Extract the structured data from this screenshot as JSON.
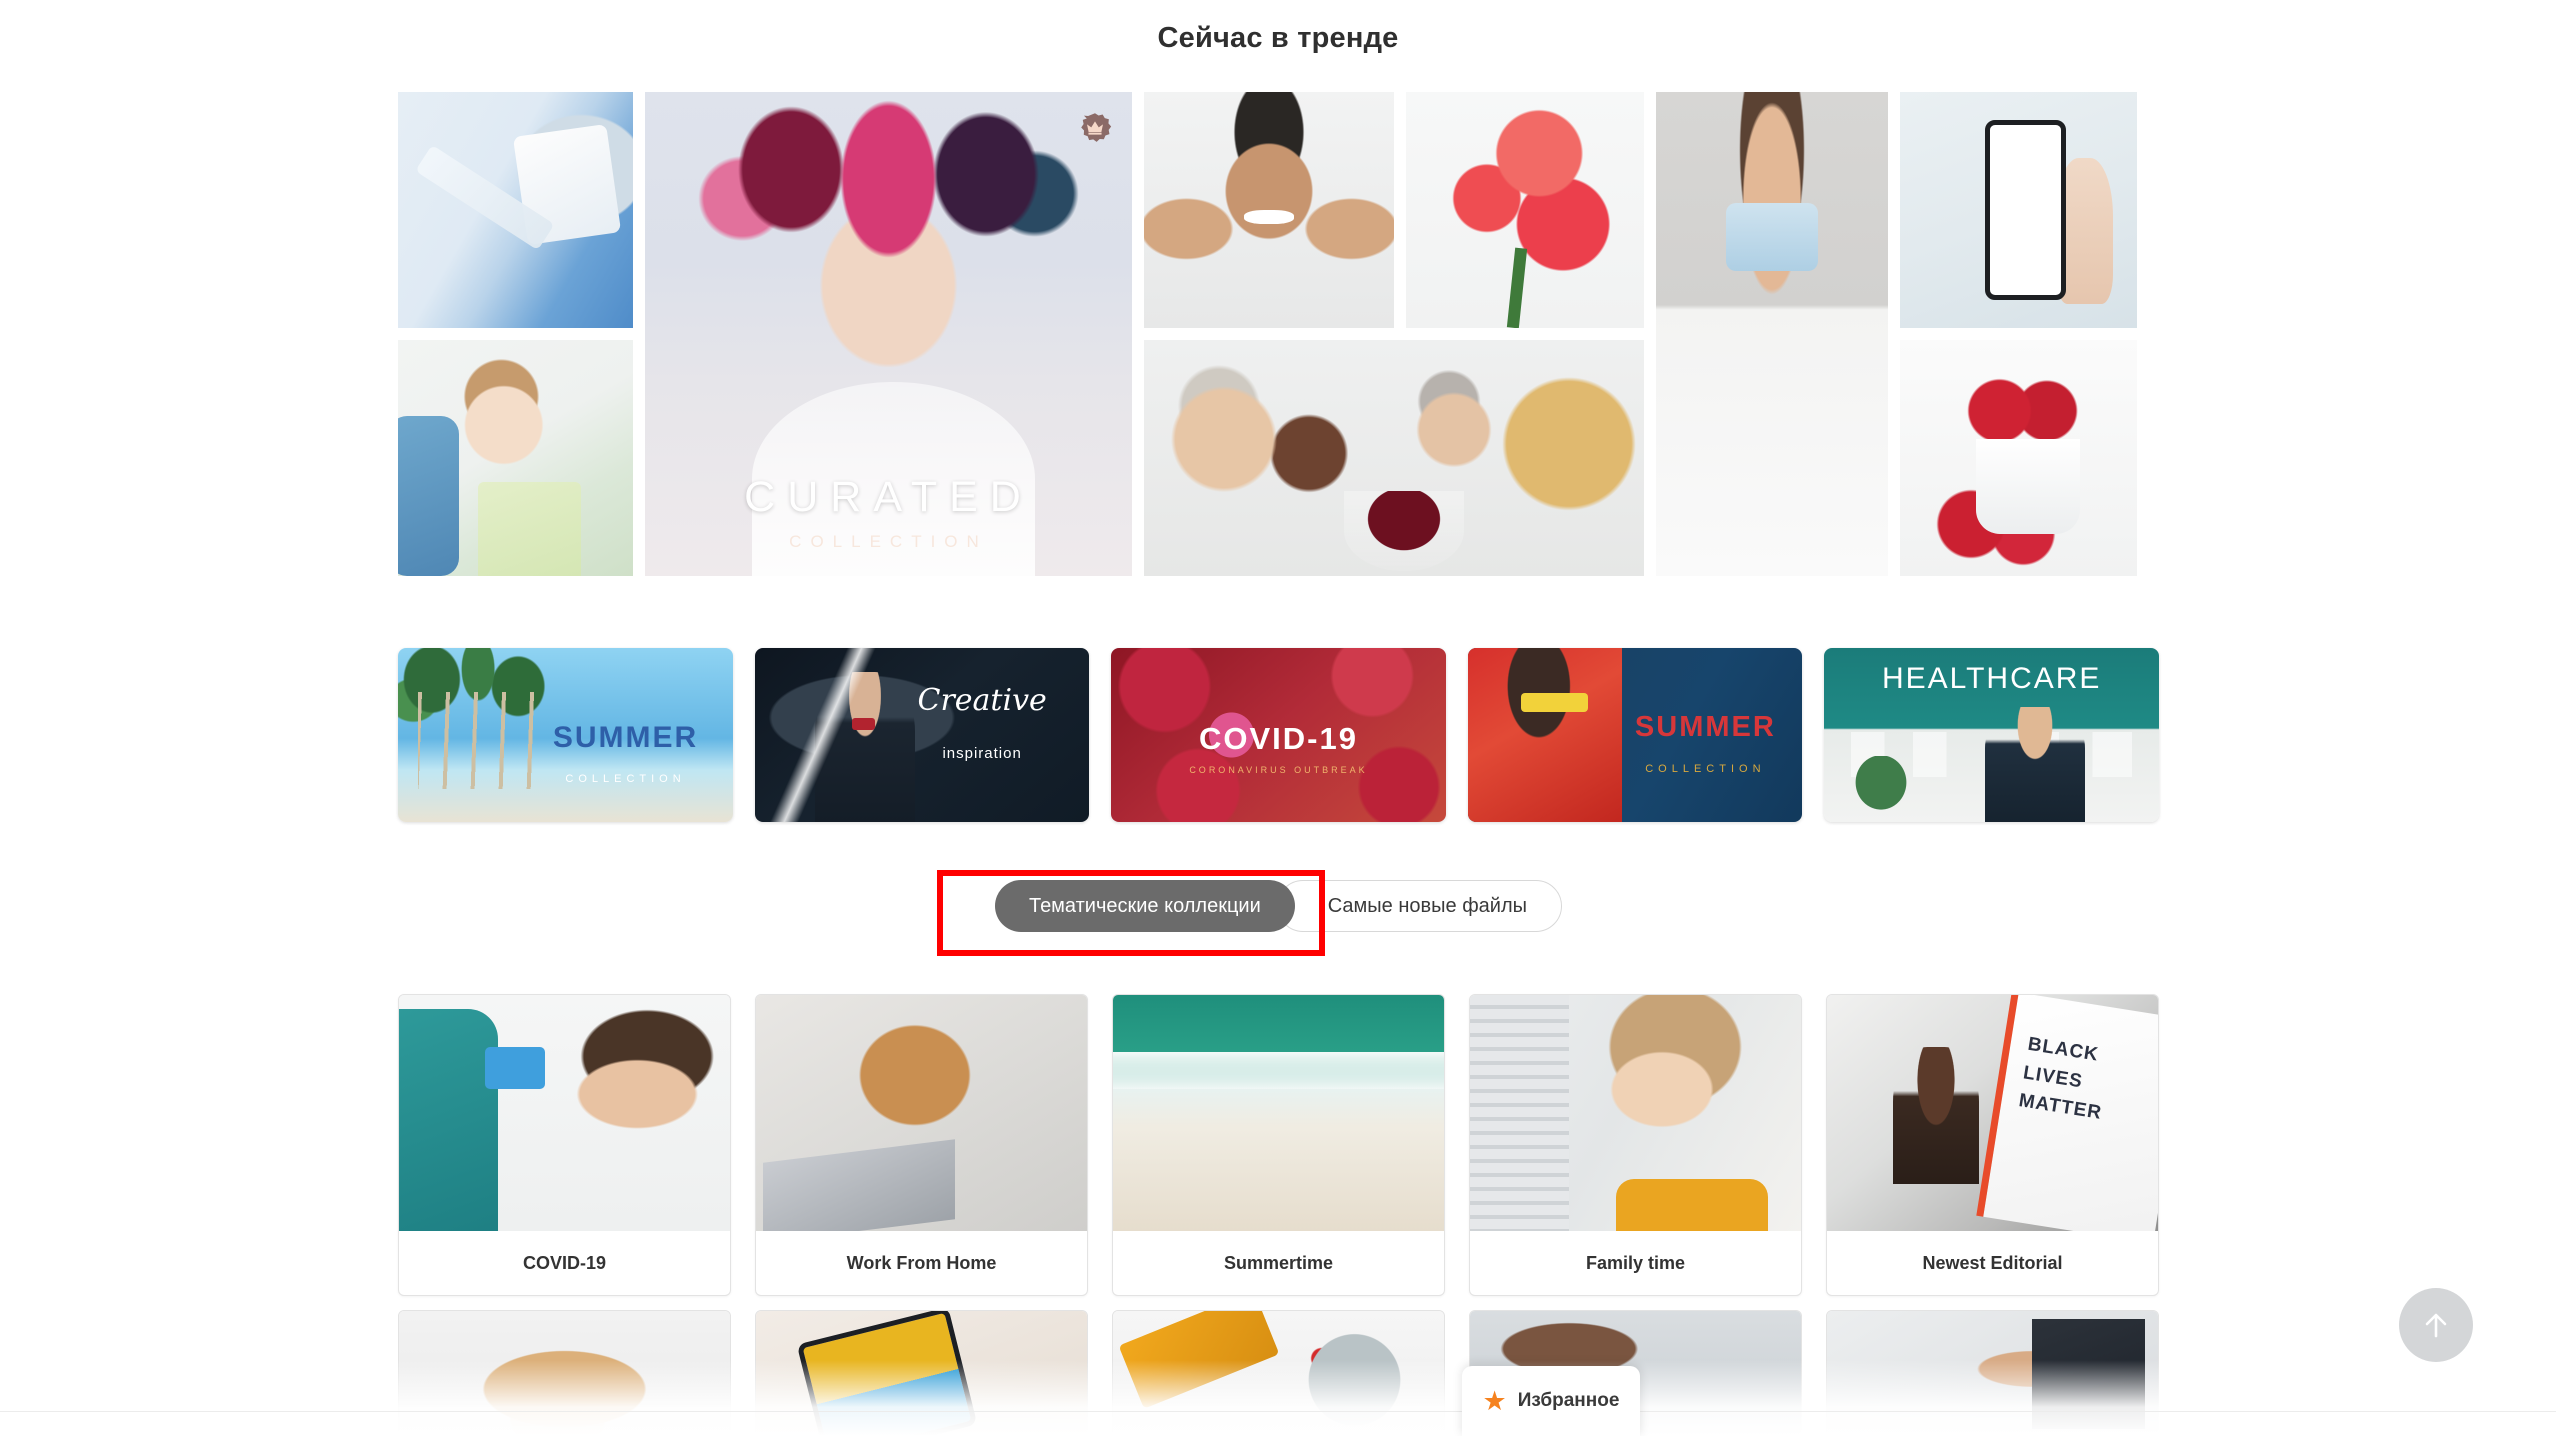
{
  "header": {
    "title": "Сейчас в тренде"
  },
  "trending": {
    "tiles": [
      {
        "name": "covid-vaccine-vial",
        "alt": "COVID 19 vaccine vial held in blue gloved hand with syringe"
      },
      {
        "name": "woman-toothache",
        "alt": "Woman in dental chair holding cheek in pain"
      },
      {
        "name": "curated-collection",
        "alt": "Blonde woman with floral crown and butterfly",
        "overlay_title": "CURATED",
        "overlay_subtitle": "COLLECTION",
        "badge": "crown-badge"
      },
      {
        "name": "man-skincare",
        "alt": "Smiling man touching his face"
      },
      {
        "name": "red-peonies",
        "alt": "Red peony flowers"
      },
      {
        "name": "friends-toasting",
        "alt": "Group of friends toasting red wine"
      },
      {
        "name": "woman-medical-mask",
        "alt": "Woman in white dress wearing medical mask, arms crossed"
      },
      {
        "name": "hand-holding-phone",
        "alt": "Hand holding smartphone with blank white screen"
      },
      {
        "name": "strawberries-cup",
        "alt": "Strawberries in a white cup"
      }
    ]
  },
  "banners": [
    {
      "name": "banner-summer-collection-beach",
      "title": "SUMMER",
      "subtitle": "COLLECTION"
    },
    {
      "name": "banner-creative-inspiration",
      "title": "Creative",
      "subtitle": "inspiration"
    },
    {
      "name": "banner-covid-19",
      "title": "COVID-19",
      "subtitle": "CORONAVIRUS OUTBREAK"
    },
    {
      "name": "banner-summer-collection-model",
      "title": "SUMMER",
      "subtitle": "COLLECTION"
    },
    {
      "name": "banner-healthcare",
      "title": "HEALTHCARE",
      "subtitle": ""
    }
  ],
  "tabs": {
    "items": [
      {
        "label": "Тематические коллекции",
        "active": true
      },
      {
        "label": "Самые новые файлы",
        "active": false
      }
    ],
    "highlight_color": "#ff0000",
    "active_bg": "#6b6b6b"
  },
  "collections": {
    "row1": [
      {
        "label": "COVID-19",
        "alt": "Nurse taking temperature of woman with infrared thermometer"
      },
      {
        "label": "Work From Home",
        "alt": "Dog lying on bed next to laptop"
      },
      {
        "label": "Summertime",
        "alt": "Aerial view of ocean waves on sandy beach"
      },
      {
        "label": "Family time",
        "alt": "Curly haired child looking out of window blinds"
      },
      {
        "label": "Newest Editorial",
        "alt": "Protester in car with Black Lives Matter sign"
      }
    ],
    "row2": [
      {
        "label": "",
        "alt": "Woman in straw hat"
      },
      {
        "label": "",
        "alt": "Hands holding phone with Covid-19 app screen"
      },
      {
        "label": "",
        "alt": "Robotic arm holding coronavirus model"
      },
      {
        "label": "",
        "alt": "Person in light clothing"
      },
      {
        "label": "",
        "alt": "Man working at desk"
      }
    ]
  },
  "favorites_button": {
    "label": "Избранное",
    "icon": "star-icon",
    "icon_color": "#f5821f"
  },
  "scroll_top_button": {
    "icon": "arrow-up-icon",
    "background": "#d4d6d8"
  }
}
